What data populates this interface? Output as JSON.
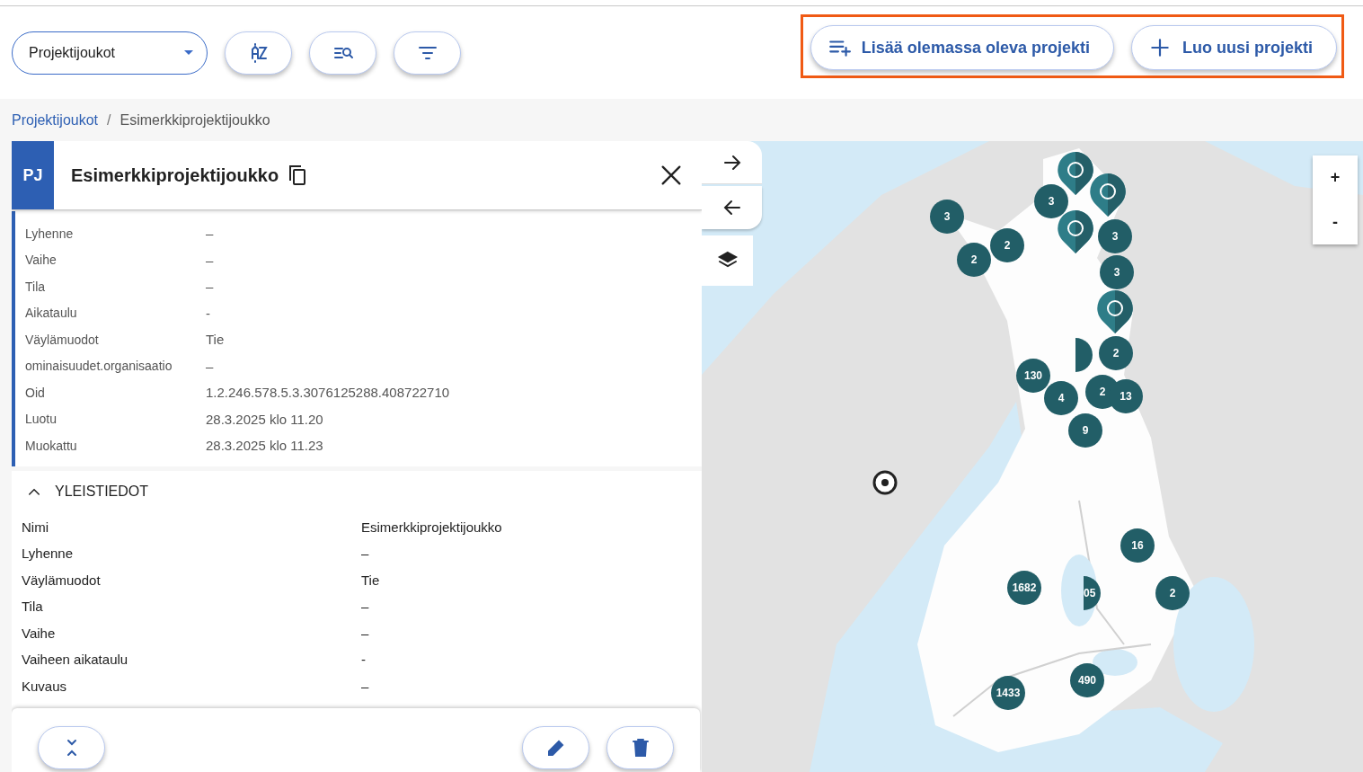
{
  "toolbar": {
    "dropdown": {
      "value": "Projektijoukot"
    },
    "icon_buttons": [
      {
        "kind": "sort"
      },
      {
        "kind": "search-list"
      },
      {
        "kind": "filter"
      }
    ],
    "highlighted": true,
    "actions": [
      {
        "kind": "add-list",
        "label": "Lisää olemassa oleva projekti"
      },
      {
        "kind": "plus",
        "label": "Luo uusi projekti"
      }
    ]
  },
  "breadcrumb": {
    "separator": "/",
    "items": [
      {
        "label": "Projektijoukot",
        "link": true
      },
      {
        "label": "Esimerkkiprojektijoukko",
        "link": false
      }
    ]
  },
  "panel": {
    "badge": "PJ",
    "title": "Esimerkkiprojektijoukko",
    "summary": [
      {
        "label": "Lyhenne",
        "value": "–"
      },
      {
        "label": "Vaihe",
        "value": "–"
      },
      {
        "label": "Tila",
        "value": "–"
      },
      {
        "label": "Aikataulu",
        "value": "-"
      },
      {
        "label": "Väylämuodot",
        "value": "Tie"
      },
      {
        "label": "ominaisuudet.organisaatio",
        "value": "–"
      },
      {
        "label": "Oid",
        "value": "1.2.246.578.5.3.3076125288.408722710"
      },
      {
        "label": "Luotu",
        "value": "28.3.2025 klo 11.20"
      },
      {
        "label": "Muokattu",
        "value": "28.3.2025 klo 11.23"
      }
    ],
    "section": {
      "title": "YLEISTIEDOT",
      "expanded": true,
      "rows": [
        {
          "label": "Nimi",
          "value": "Esimerkkiprojektijoukko"
        },
        {
          "label": "Lyhenne",
          "value": "–"
        },
        {
          "label": "Väylämuodot",
          "value": "Tie"
        },
        {
          "label": "Tila",
          "value": "–"
        },
        {
          "label": "Vaihe",
          "value": "–"
        },
        {
          "label": "Vaiheen aikataulu",
          "value": "-"
        },
        {
          "label": "Kuvaus",
          "value": "–"
        }
      ]
    },
    "footer_buttons": [
      {
        "kind": "collapse"
      },
      {
        "kind": "edit"
      },
      {
        "kind": "delete"
      }
    ]
  },
  "map": {
    "controls": [
      {
        "kind": "forward"
      },
      {
        "kind": "back"
      },
      {
        "kind": "layers"
      }
    ],
    "zoom": {
      "in": "+",
      "out": "-"
    },
    "markers": [
      {
        "kind": "cluster",
        "count": "3"
      },
      {
        "kind": "cluster",
        "count": "2"
      },
      {
        "kind": "cluster",
        "count": "2"
      },
      {
        "kind": "cluster",
        "count": "3"
      },
      {
        "kind": "pin"
      },
      {
        "kind": "pin"
      },
      {
        "kind": "pin"
      },
      {
        "kind": "cluster",
        "count": "3"
      },
      {
        "kind": "cluster",
        "count": "3"
      },
      {
        "kind": "pin"
      },
      {
        "kind": "half"
      },
      {
        "kind": "cluster",
        "count": "2"
      },
      {
        "kind": "cluster",
        "count": "130"
      },
      {
        "kind": "cluster",
        "count": "4"
      },
      {
        "kind": "cluster",
        "count": "2"
      },
      {
        "kind": "cluster",
        "count": "13"
      },
      {
        "kind": "cluster",
        "count": "9"
      },
      {
        "kind": "cluster",
        "count": "16"
      },
      {
        "kind": "cluster",
        "count": "1682"
      },
      {
        "kind": "half",
        "count": "05"
      },
      {
        "kind": "cluster",
        "count": "2"
      },
      {
        "kind": "cluster",
        "count": "490"
      },
      {
        "kind": "cluster",
        "count": "1433"
      },
      {
        "kind": "target"
      }
    ]
  }
}
